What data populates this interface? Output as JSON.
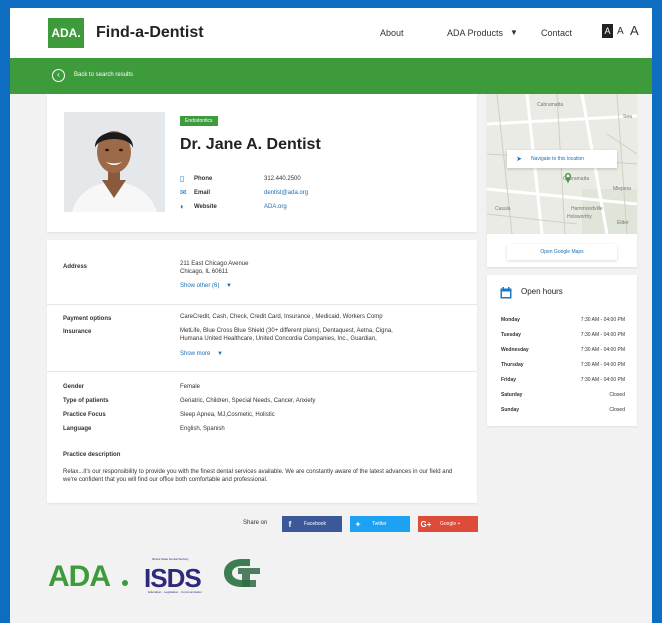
{
  "header": {
    "logo": "ADA.",
    "title": "Find-a-Dentist",
    "nav": {
      "about": "About",
      "products": "ADA Products",
      "contact": "Contact"
    },
    "font_size": {
      "small": "A",
      "medium": "A",
      "large": "A"
    }
  },
  "greenbar": {
    "back": "Back to search results"
  },
  "profile": {
    "badge": "Endodontics",
    "name": "Dr. Jane A. Dentist",
    "contact": [
      {
        "icon": "phone-icon",
        "label": "Phone",
        "value": "312.440.2500"
      },
      {
        "icon": "email-icon",
        "label": "Email",
        "value": "dentist@ada.org"
      },
      {
        "icon": "globe-icon",
        "label": "Website",
        "value": "ADA.org"
      }
    ]
  },
  "details": {
    "address_label": "Address",
    "address_line1": "211 East Chicago Avenue",
    "address_line2": "Chicago, IL 60611",
    "show_other": "Show other (6)",
    "payment_label": "Payment options",
    "payment_value": "CareCredit, Cash, Check, Credit Card, Insurance , Medicaid, Workers Comp",
    "insurance_label": "Insurance",
    "insurance_line1": "MetLife, Blue Cross Blue Shield (30+ different plans), Dentaquest, Aetna, Cigna,",
    "insurance_line2": "Humana United Healthcare, United Concordia Companies, Inc., Guardian,",
    "show_more": "Show more",
    "gender_label": "Gender",
    "gender_value": "Female",
    "patients_label": "Type of patients",
    "patients_value": "Geriatric, Children, Special Needs, Cancer, Anxiety",
    "focus_label": "Practice Focus",
    "focus_value": "Sleep Apnea, MJ,Cosmetic, Holistic",
    "language_label": "Language",
    "language_value": "English, Spanish",
    "desc_label": "Practice description",
    "desc_text": "Relax...it's our responsibility to provide you with the finest dental services available. We are constantly aware of the latest advances in our field and we're confident that you will find our office both comfortable and professional."
  },
  "share": {
    "label": "Share on",
    "facebook": "Facebook",
    "twitter": "Twitter",
    "google": "Google +",
    "colors": {
      "facebook": "#3b5998",
      "twitter": "#1da1f2",
      "google": "#dd4b39"
    }
  },
  "logos": {
    "ada": "ADA",
    "isds": "ISDS",
    "isds_top": "Illinois State Dental Society",
    "isds_bottom": "Education · Legislation · Communication"
  },
  "map": {
    "navigate": "Navigate to this location",
    "open_maps": "Open Google Maps",
    "labels": [
      "Cabramatta",
      "Sea",
      "Cabramatta",
      "Hammondville",
      "Holsworthy",
      "Casula",
      "Miepera",
      "Elder"
    ]
  },
  "hours": {
    "title": "Open hours",
    "days": [
      {
        "day": "Monday",
        "time": "7:30 AM - 04:00 PM"
      },
      {
        "day": "Tuesday",
        "time": "7:30 AM - 04:00 PM"
      },
      {
        "day": "Wednesday",
        "time": "7:30 AM - 04:00 PM"
      },
      {
        "day": "Thursday",
        "time": "7:30 AM - 04:00 PM"
      },
      {
        "day": "Friday",
        "time": "7:30 AM - 04:00 PM"
      },
      {
        "day": "Saturday",
        "time": "Closed"
      },
      {
        "day": "Sunday",
        "time": "Closed"
      }
    ]
  },
  "colors": {
    "brand_green": "#3e9b3c",
    "link_blue": "#1a6fb5",
    "frame_blue": "#0e6dc0"
  }
}
